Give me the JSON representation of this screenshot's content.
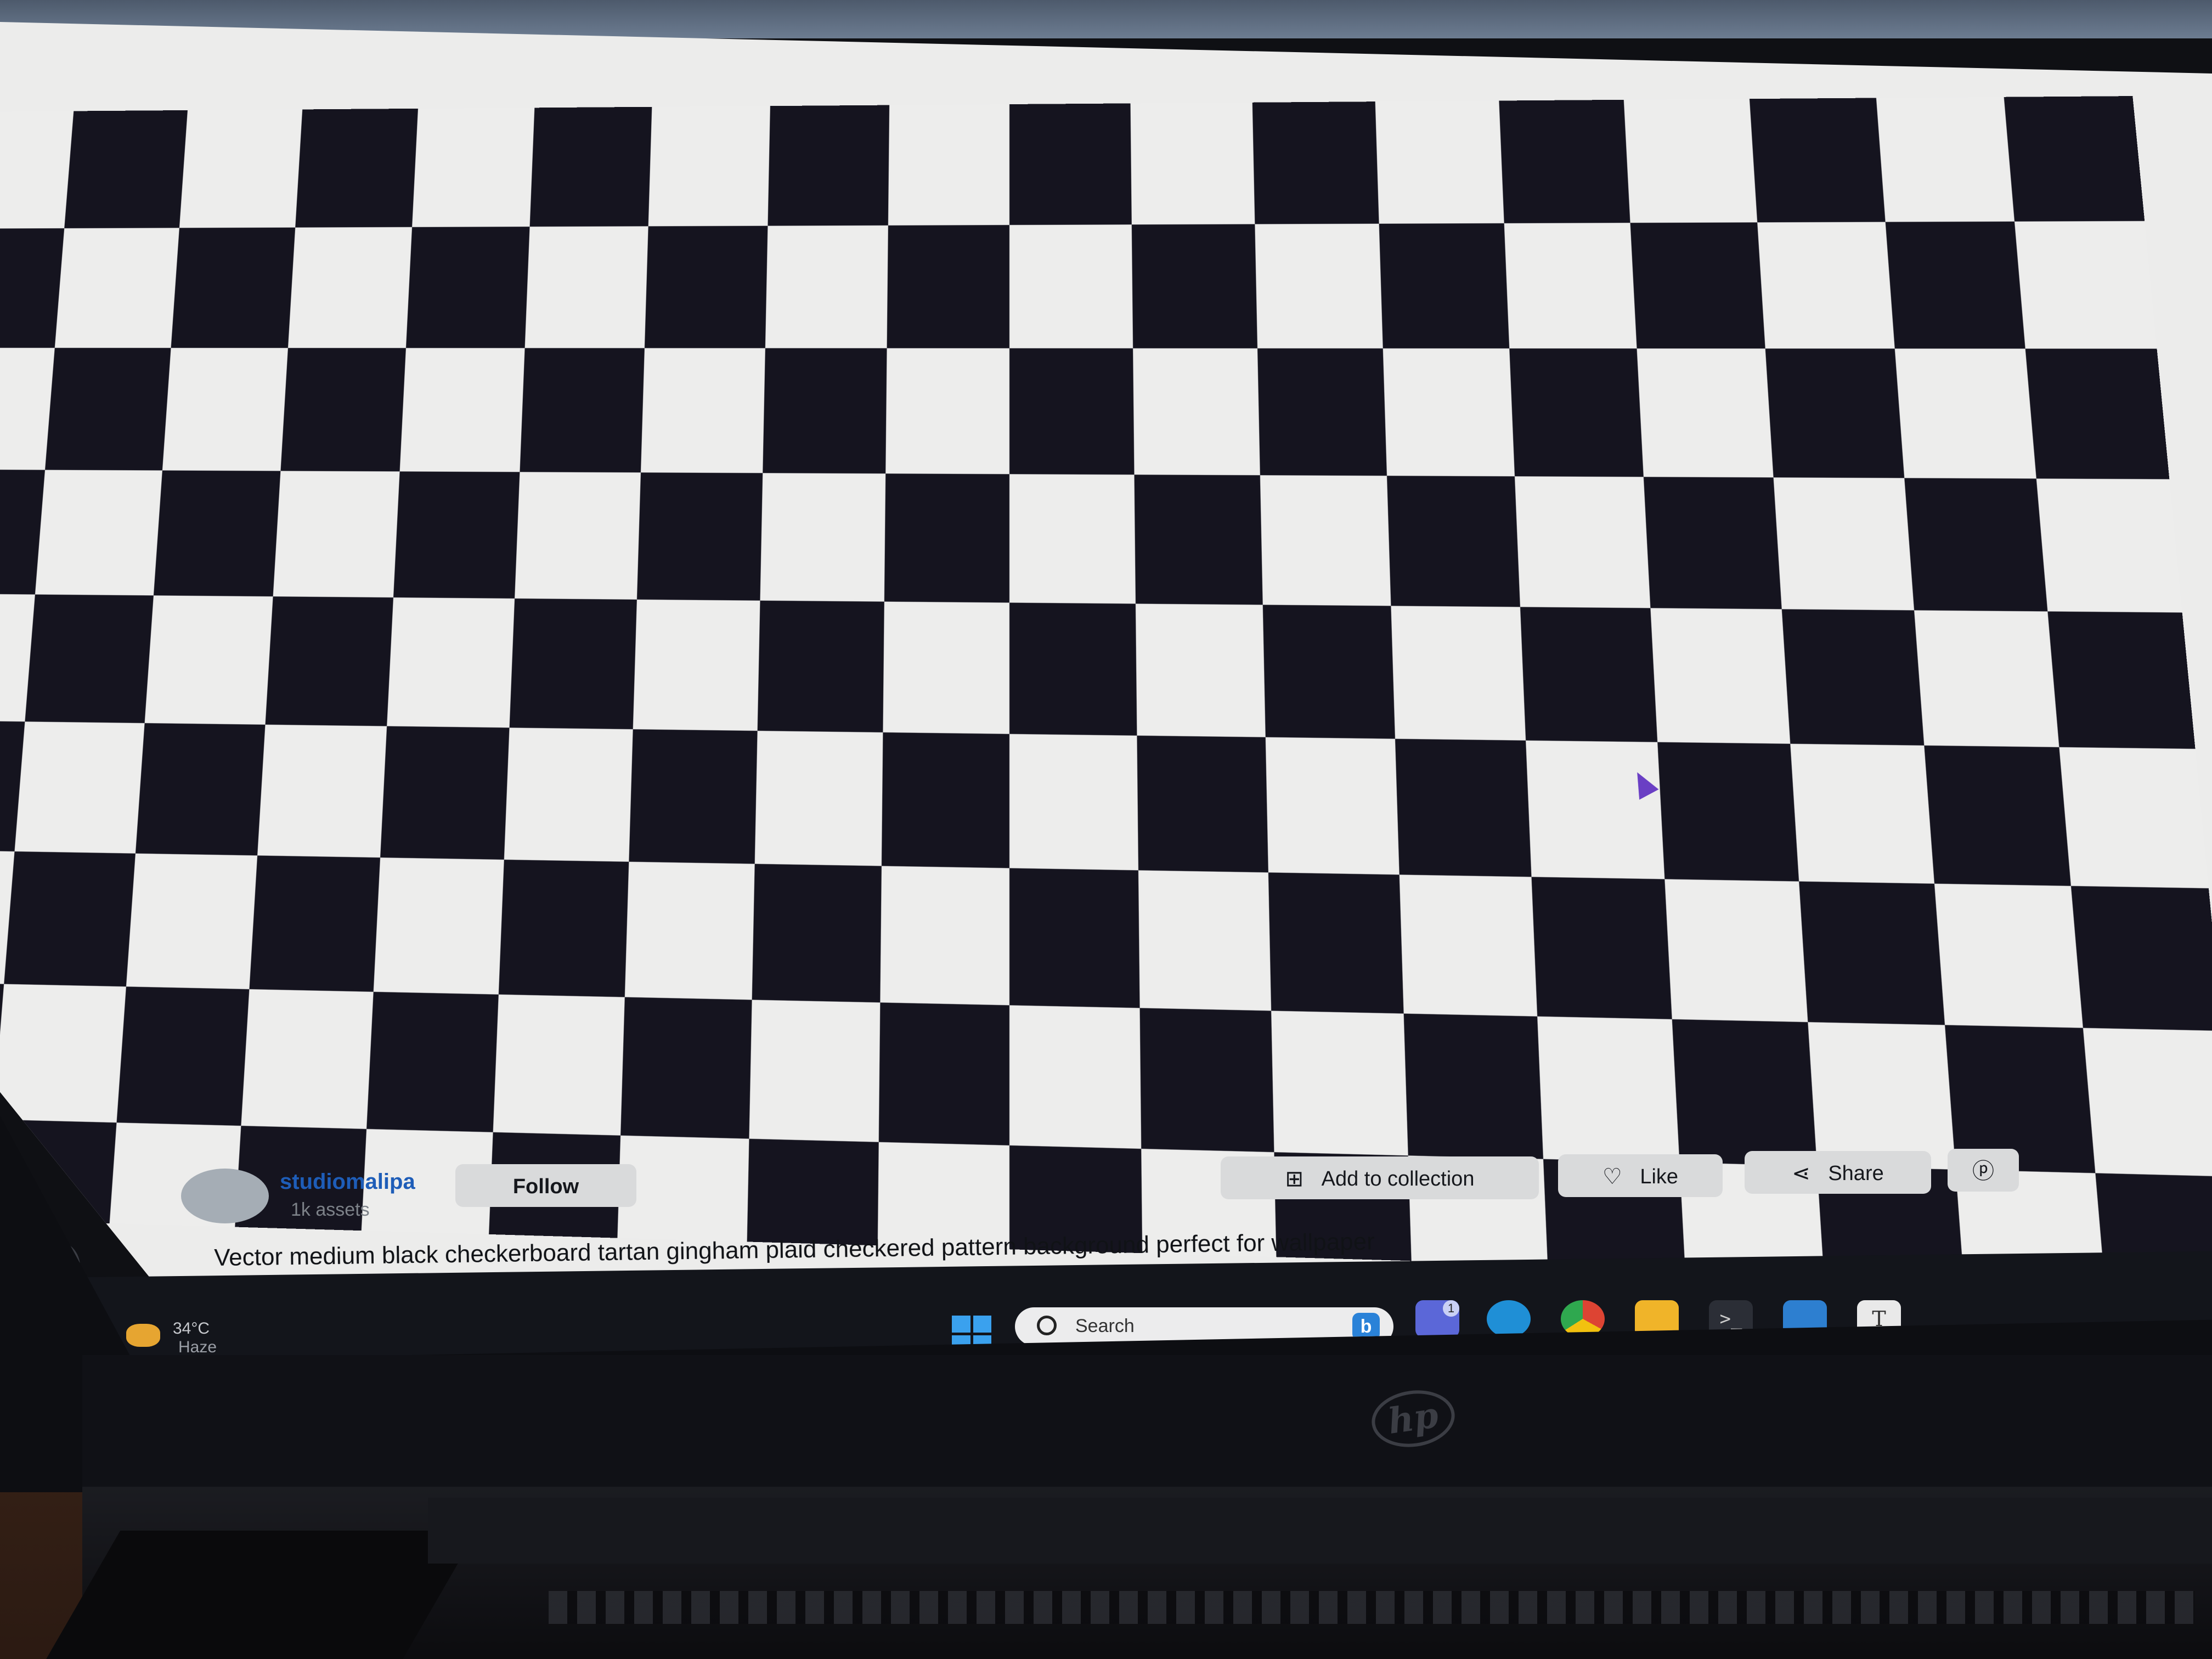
{
  "author": {
    "name": "studiomalipa",
    "assets": "1k assets",
    "follow_label": "Follow"
  },
  "actions": {
    "add_to_collection": "Add to collection",
    "like": "Like",
    "share": "Share"
  },
  "caption": "Vector medium black checkerboard tartan gingham plaid checkered pattern background perfect for wallpaper",
  "taskbar": {
    "weather_temp": "34°C",
    "weather_desc": "Haze",
    "search_placeholder": "Search",
    "teams_badge": "1",
    "apps": [
      "teams-icon",
      "edge-icon",
      "chrome-icon",
      "file-explorer-icon",
      "terminal-icon",
      "vscode-icon",
      "typora-icon"
    ]
  },
  "icons": {
    "add_collection": "plus-square-icon",
    "like": "heart-icon",
    "share": "share-icon",
    "pinterest": "pinterest-icon"
  },
  "colors": {
    "author_link": "#1e5db8",
    "checker_dark": "#15141f",
    "checker_light": "#ededec",
    "cursor": "#6a3fc4"
  }
}
